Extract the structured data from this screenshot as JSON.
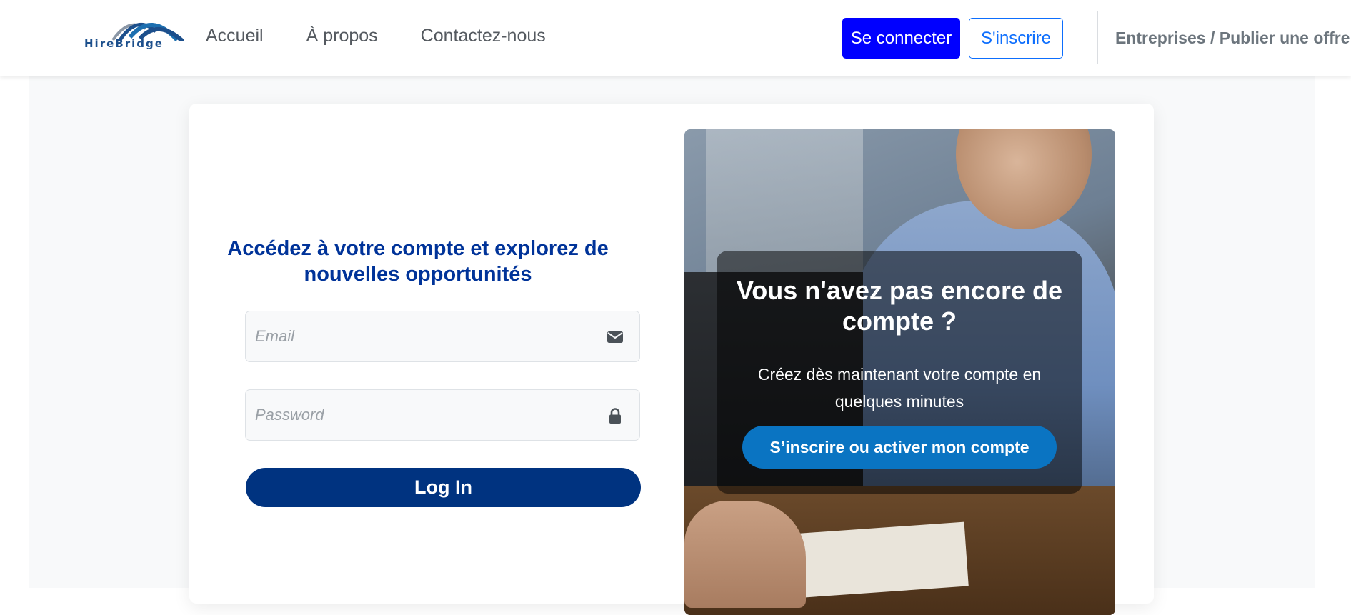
{
  "brand": {
    "logo_text": "HireBridge",
    "logo_color": "#1c4f8c"
  },
  "nav": {
    "links": [
      {
        "label": "Accueil"
      },
      {
        "label": "À propos"
      },
      {
        "label": "Contactez-nous"
      }
    ],
    "login_label": "Se connecter",
    "register_label": "S'inscrire",
    "business_label": "Entreprises / Publier une offre"
  },
  "login": {
    "title": "Accédez à votre compte et explorez de nouvelles opportunités",
    "email": {
      "placeholder": "Email",
      "value": "",
      "icon": "envelope-icon"
    },
    "password": {
      "placeholder": "Password",
      "value": "",
      "icon": "lock-icon"
    },
    "submit_label": "Log In"
  },
  "promo": {
    "title": "Vous n'avez pas encore de compte ?",
    "text": "Créez dès maintenant votre compte en quelques minutes",
    "cta_label": "S’inscrire ou activer mon compte"
  },
  "colors": {
    "primary_blue": "#0000ff",
    "outline_blue": "#0d6efd",
    "title_navy": "#003399",
    "submit_navy": "#003380",
    "cta_blue": "#0a74c2"
  }
}
